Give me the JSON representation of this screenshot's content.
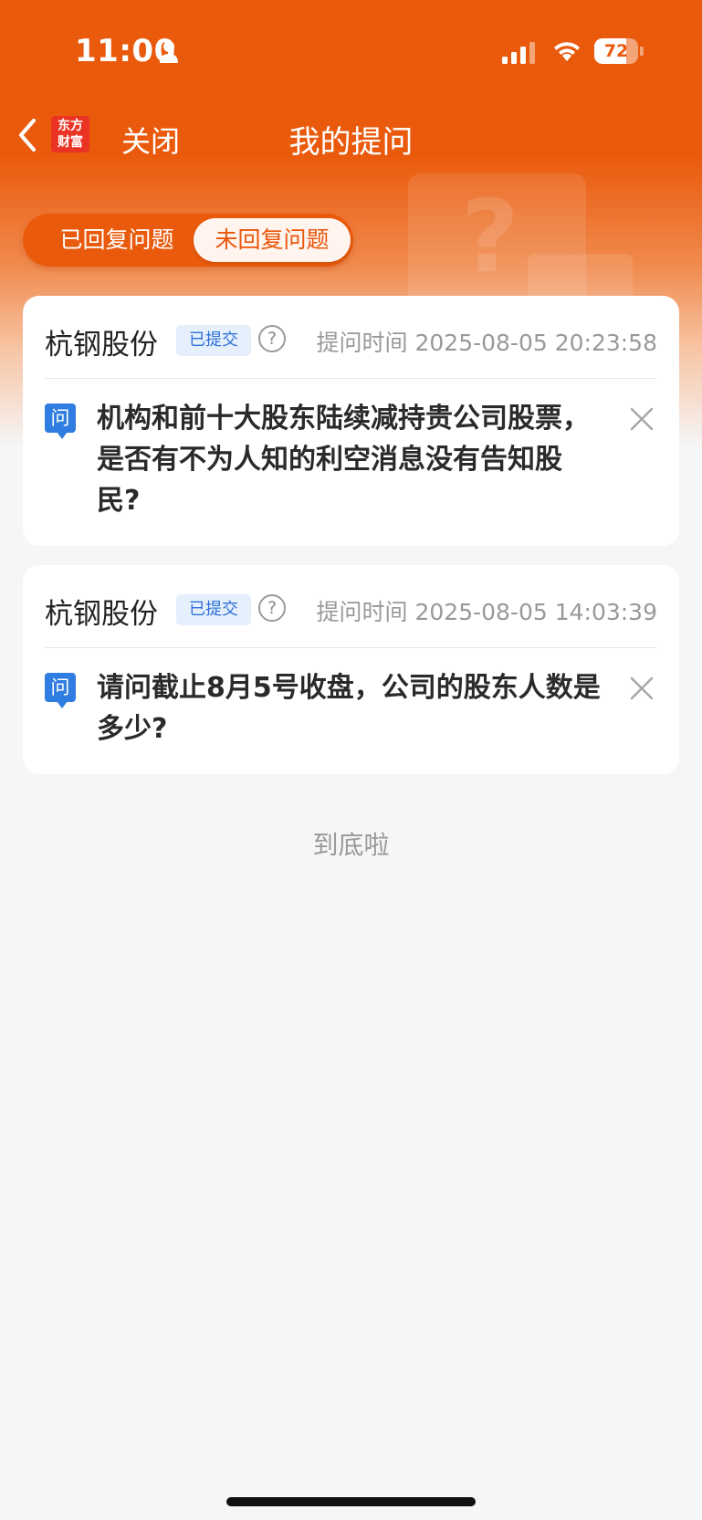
{
  "status_bar": {
    "time": "11:00",
    "battery": "72"
  },
  "nav": {
    "logo_line1": "东方",
    "logo_line2": "财富",
    "close_label": "关闭",
    "title": "我的提问"
  },
  "tabs": {
    "answered": "已回复问题",
    "unanswered": "未回复问题"
  },
  "questions": [
    {
      "company": "杭钢股份",
      "status": "已提交",
      "help": "?",
      "time": "提问时间 2025-08-05 20:23:58",
      "badge": "问",
      "text": "机构和前十大股东陆续减持贵公司股票，是否有不为人知的利空消息没有告知股民?"
    },
    {
      "company": "杭钢股份",
      "status": "已提交",
      "help": "?",
      "time": "提问时间 2025-08-05 14:03:39",
      "badge": "问",
      "text": "请问截止8月5号收盘，公司的股东人数是多少?"
    }
  ],
  "footer": {
    "end_text": "到底啦"
  },
  "colors": {
    "brand_orange": "#ea5a0c",
    "badge_blue": "#2f7de1",
    "logo_red": "#ea3323"
  },
  "icons": [
    "person-icon",
    "signal-icon",
    "wifi-icon",
    "battery-icon",
    "back-chevron-icon",
    "help-icon",
    "question-icon",
    "close-x-icon"
  ]
}
